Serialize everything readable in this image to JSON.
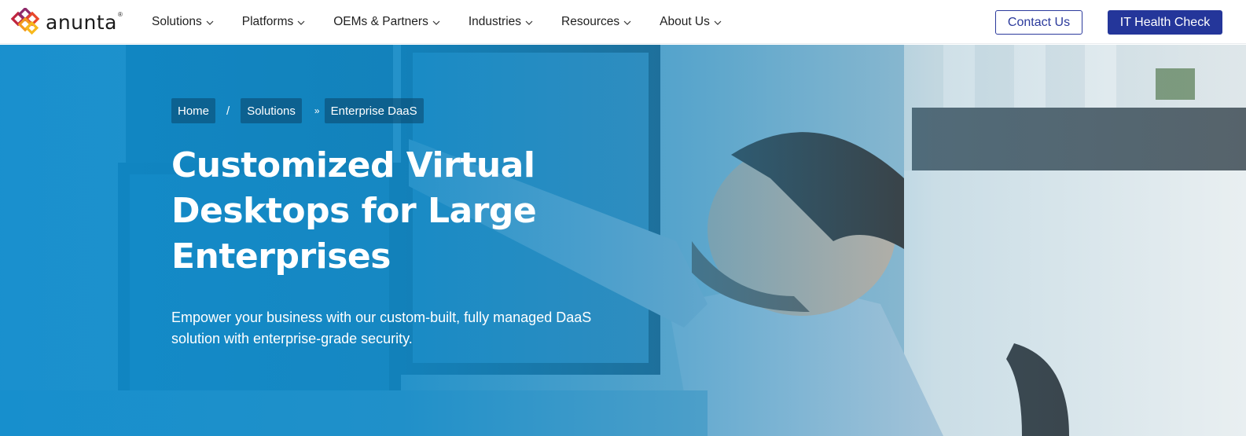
{
  "brand": {
    "name": "anunta",
    "reg_mark": "®"
  },
  "nav": {
    "items": [
      {
        "label": "Solutions"
      },
      {
        "label": "Platforms"
      },
      {
        "label": "OEMs & Partners"
      },
      {
        "label": "Industries"
      },
      {
        "label": "Resources"
      },
      {
        "label": "About Us"
      }
    ],
    "icon": "chevron-down-icon"
  },
  "header_actions": {
    "contact_label": "Contact Us",
    "health_check_label": "IT Health Check"
  },
  "breadcrumb": {
    "home": "Home",
    "separator_1": "/",
    "solutions": "Solutions",
    "separator_2": "»",
    "current": "Enterprise DaaS"
  },
  "hero": {
    "title_line_1": "Customized Virtual",
    "title_line_2": "Desktops for Large",
    "title_line_3": "Enterprises",
    "subtitle_line_1": "Empower your business with our custom-built, fully managed DaaS",
    "subtitle_line_2": "solution with enterprise-grade security."
  },
  "colors": {
    "primary_button": "#24369a",
    "outline_button": "#2b3a9c",
    "hero_overlay": "#0e8ccd"
  }
}
